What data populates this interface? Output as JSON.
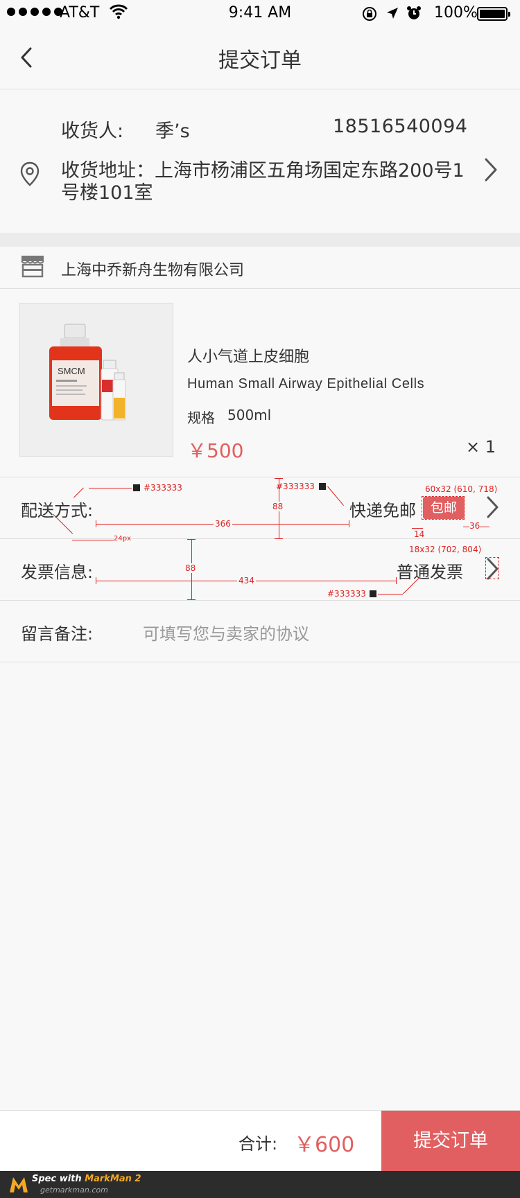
{
  "status_bar": {
    "carrier": "AT&T",
    "time": "9:41 AM",
    "battery": "100%"
  },
  "nav": {
    "title": "提交订单"
  },
  "address": {
    "recipient_label": "收货人:",
    "recipient_name": "季’s",
    "phone": "18516540094",
    "address_text": "收货地址：上海市杨浦区五角场国定东路200号1号楼101室"
  },
  "shop": {
    "name": "上海中乔新舟生物有限公司"
  },
  "product": {
    "name_cn": "人小气道上皮细胞",
    "name_en": "Human Small Airway Epithelial Cells",
    "spec_label": "规格",
    "spec_value": "500ml",
    "price": "￥500",
    "quantity": "× 1",
    "bottle_label": "SMCM"
  },
  "delivery": {
    "label": "配送方式:",
    "value": "快递免邮",
    "badge": "包邮"
  },
  "invoice": {
    "label": "发票信息:",
    "value": "普通发票"
  },
  "remark": {
    "label": "留言备注:",
    "placeholder": "可填写您与卖家的协议"
  },
  "footer": {
    "total_label": "合计:",
    "total_value": "￥600",
    "submit_label": "提交订单"
  },
  "annotations": {
    "color_a": "#333333",
    "color_b": "#333333",
    "color_c": "#333333",
    "height_a": "88",
    "height_b": "88",
    "width_a": "366",
    "width_b": "434",
    "font_size": "24px",
    "badge_spec": "60x32 (610, 718)",
    "chevron_spec": "18x32 (702, 804)",
    "gap_a": "14",
    "gap_b": "36"
  },
  "markman": {
    "brand": "Spec with",
    "product": "MarkMan 2",
    "url": "getmarkman.com"
  },
  "colors": {
    "accent": "#e15f60",
    "text": "#333333",
    "placeholder": "#999999",
    "background": "#f8f8f8"
  },
  "icons": {
    "back": "chevron-left-icon",
    "location": "location-pin-icon",
    "store": "store-icon",
    "forward": "chevron-right-icon"
  }
}
